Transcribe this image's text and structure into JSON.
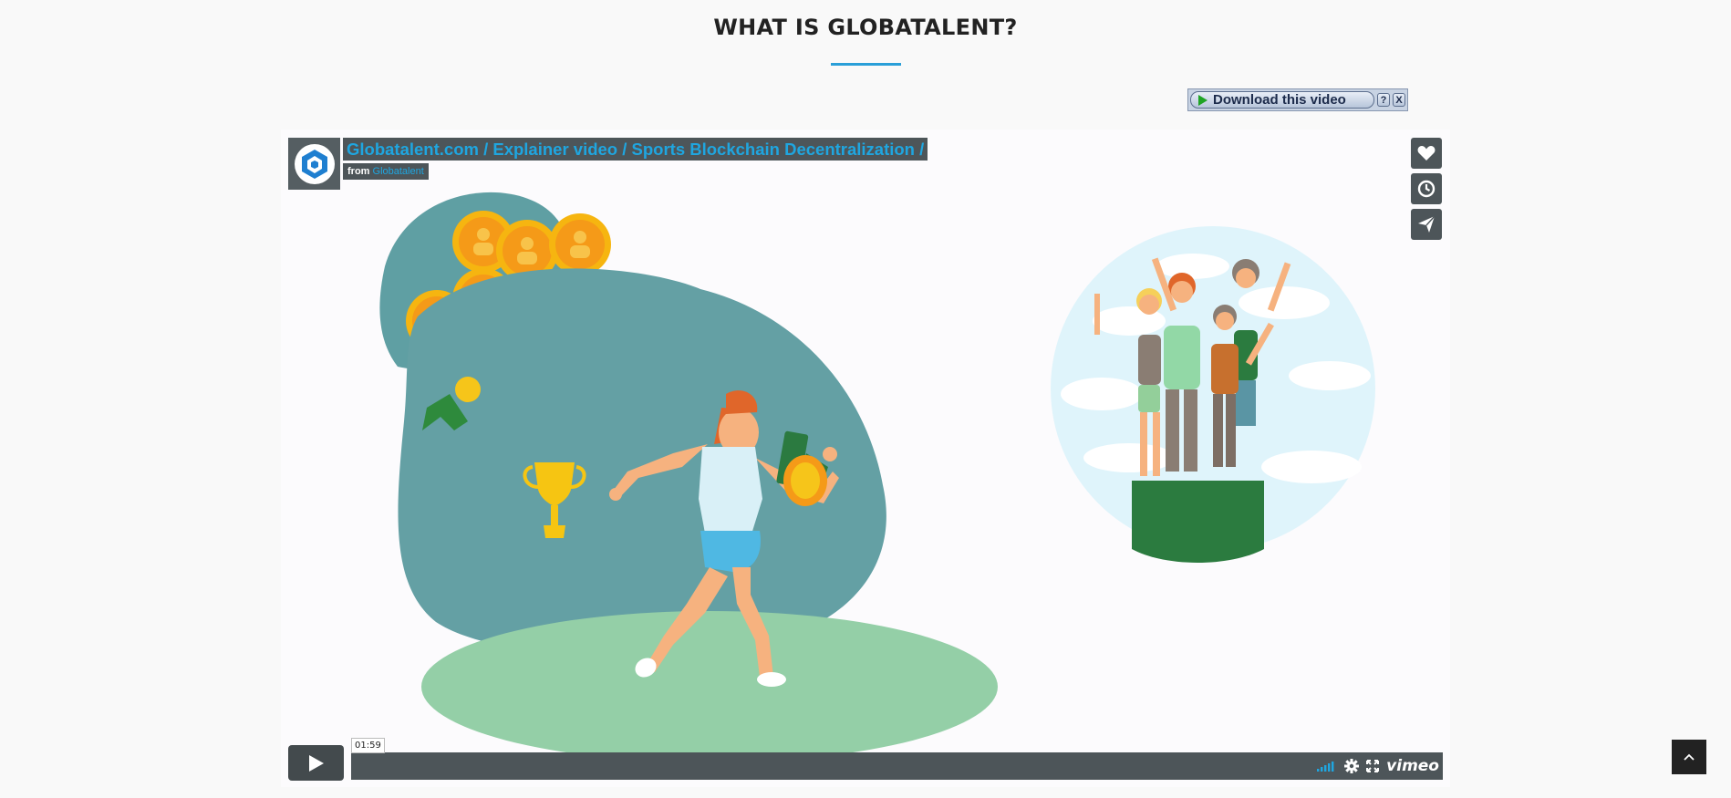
{
  "section": {
    "title": "WHAT IS GLOBATALENT?"
  },
  "download_bar": {
    "label": "Download this video",
    "help": "?",
    "close": "X"
  },
  "video": {
    "title": "Globatalent.com / Explainer video / Sports Blockchain Decentralization /",
    "from_label": "from",
    "owner": "Globatalent",
    "timecode": "01:59",
    "brand": "vimeo"
  },
  "icons": {
    "like": "heart-icon",
    "watch_later": "clock-icon",
    "share": "paper-plane-icon",
    "play": "play-icon",
    "volume": "volume-bars-icon",
    "settings": "gear-icon",
    "fullscreen": "fullscreen-icon",
    "scroll_top": "chevron-up-icon"
  },
  "colors": {
    "accent": "#2a9fd8",
    "video_title": "#1fa6e0",
    "player_chrome": "#4d5559"
  }
}
